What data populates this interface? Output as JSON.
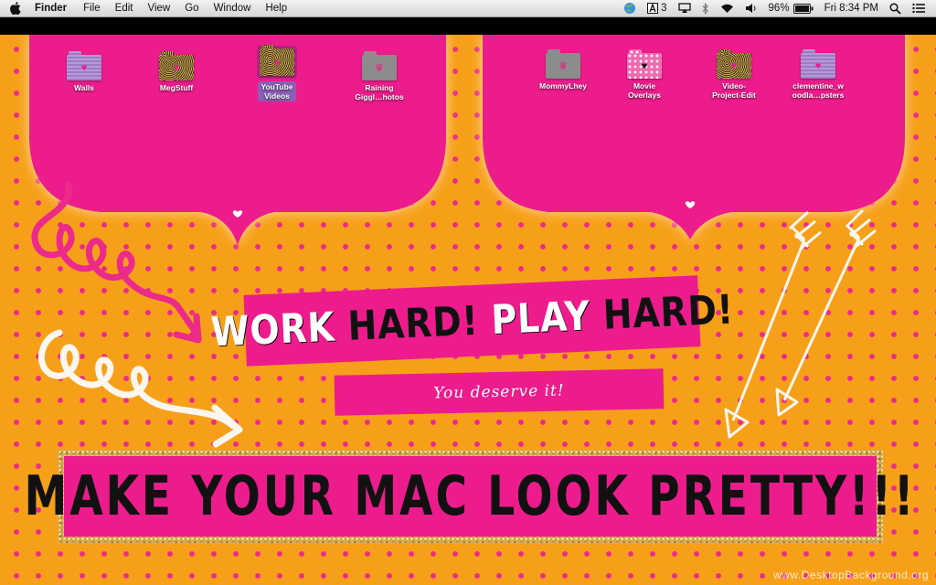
{
  "menubar": {
    "app": "Finder",
    "items": [
      "File",
      "Edit",
      "View",
      "Go",
      "Window",
      "Help"
    ],
    "adobe_badge": "3",
    "battery": "96%",
    "clock": "Fri 8:34 PM"
  },
  "desktop": {
    "icons": [
      {
        "label": "Walls",
        "style": "stripe",
        "glyph": "♥"
      },
      {
        "label": "MegStuff",
        "style": "gold",
        "glyph": "♥"
      },
      {
        "label": "YouTube Videos",
        "style": "gold",
        "glyph": "♥",
        "selected": true
      },
      {
        "label": "Raining Giggl…hotos",
        "style": "grey",
        "glyph": "♛"
      },
      {
        "label": "MommyLhey",
        "style": "grey",
        "glyph": "♛"
      },
      {
        "label": "Movie Overlays",
        "style": "dots",
        "glyph": "♥"
      },
      {
        "label": "Video-Project-Edit",
        "style": "gold",
        "glyph": "♥"
      },
      {
        "label": "clementine_w oodla…psters",
        "style": "stripe",
        "glyph": "♥"
      }
    ],
    "banner_work": {
      "w1": "WORK",
      "b1": "HARD!",
      "w2": "PLAY",
      "b2": "HARD!"
    },
    "banner_deserve": "You deserve it!",
    "banner_pretty": "MAKE YOUR MAC LOOK PRETTY!!!",
    "watermark": "www.DesktopBackground.org"
  },
  "colors": {
    "orange": "#f6a01a",
    "pink": "#ec1c8c",
    "dot": "#ec2a8a"
  }
}
